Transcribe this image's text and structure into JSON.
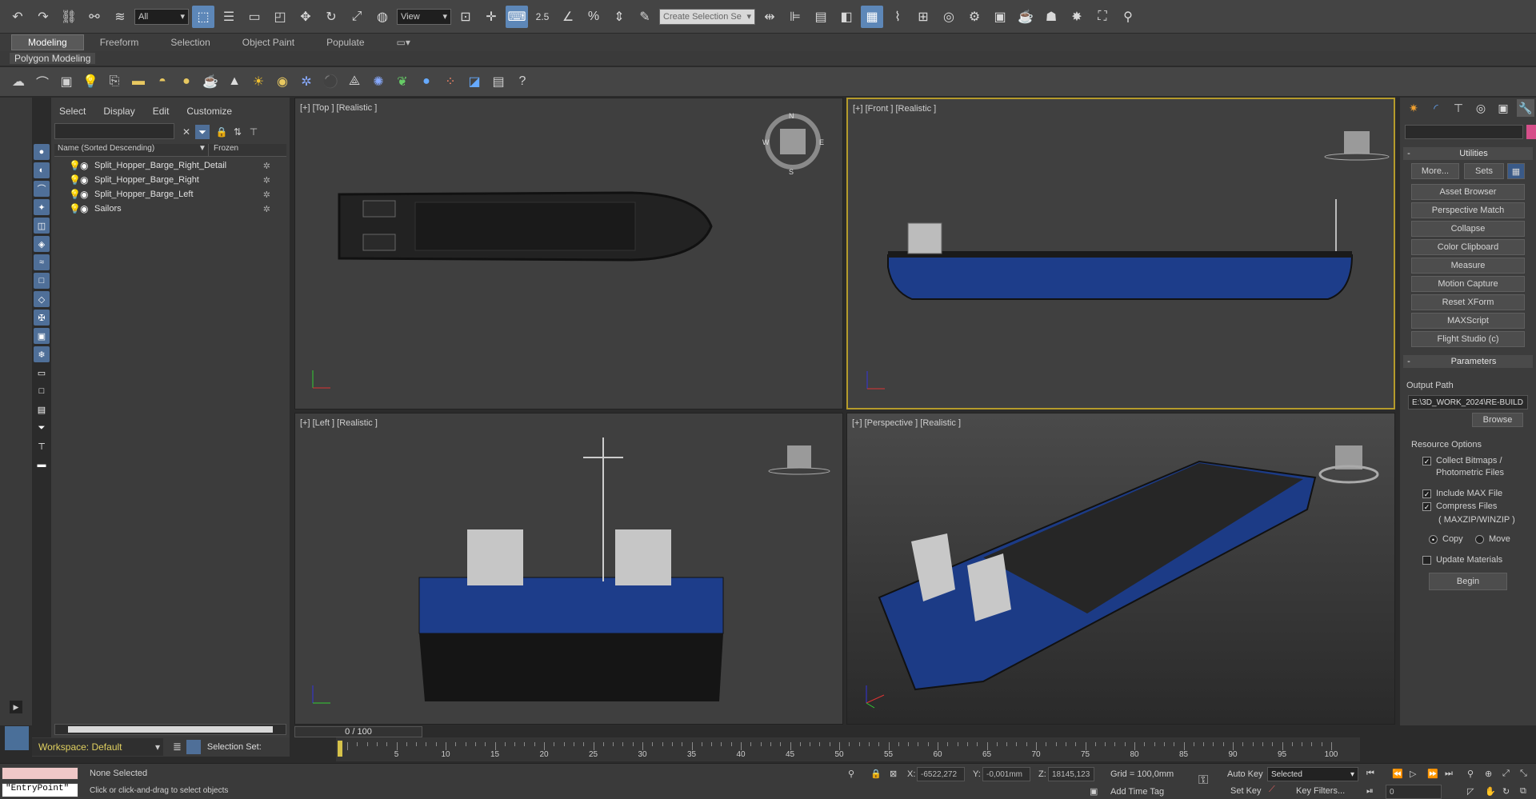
{
  "toolbar": {
    "filter_value": "All",
    "view_value": "View",
    "snap_value": "2.5",
    "selection_set_placeholder": "Create Selection Se"
  },
  "ribbon": {
    "tabs": [
      "Modeling",
      "Freeform",
      "Selection",
      "Object Paint",
      "Populate"
    ],
    "sub_label": "Polygon Modeling"
  },
  "scene_explorer": {
    "menu": [
      "Select",
      "Display",
      "Edit",
      "Customize"
    ],
    "col_name": "Name (Sorted Descending)",
    "col_frozen": "Frozen",
    "rows": [
      {
        "name": "Split_Hopper_Barge_Right_Detail"
      },
      {
        "name": "Split_Hopper_Barge_Right"
      },
      {
        "name": "Split_Hopper_Barge_Left"
      },
      {
        "name": "Sailors"
      }
    ]
  },
  "viewports": {
    "top": "[+] [Top ] [Realistic ]",
    "front": "[+] [Front ] [Realistic ]",
    "left": "[+] [Left ] [Realistic ]",
    "persp": "[+] [Perspective ] [Realistic ]"
  },
  "compass": {
    "n": "N",
    "s": "S",
    "e": "E",
    "w": "W"
  },
  "cmd_panel": {
    "utilities_title": "Utilities",
    "more": "More...",
    "sets": "Sets",
    "buttons": [
      "Asset Browser",
      "Perspective Match",
      "Collapse",
      "Color Clipboard",
      "Measure",
      "Motion Capture",
      "Reset XForm",
      "MAXScript",
      "Flight Studio (c)"
    ],
    "parameters_title": "Parameters",
    "output_path_label": "Output Path",
    "output_path_value": "E:\\3D_WORK_2024\\RE-BUILD",
    "browse": "Browse",
    "resource_options": "Resource Options",
    "collect_bitmaps": "Collect Bitmaps /",
    "photometric": "Photometric Files",
    "include_max": "Include MAX File",
    "compress": "Compress Files",
    "maxzip": "( MAXZIP/WINZIP )",
    "copy": "Copy",
    "move": "Move",
    "update_materials": "Update Materials",
    "begin": "Begin"
  },
  "bottom": {
    "workspace": "Workspace: Default",
    "selection_set": "Selection Set:",
    "frame_counter": "0 / 100",
    "ticks": [
      "5",
      "10",
      "15",
      "20",
      "25",
      "30",
      "35",
      "40",
      "45",
      "50",
      "55",
      "60",
      "65",
      "70",
      "75",
      "80",
      "85",
      "90",
      "95",
      "100"
    ],
    "entry_point": "\"EntryPoint\"",
    "none_selected": "None Selected",
    "hint": "Click or click-and-drag to select objects",
    "x_label": "X:",
    "x_value": "-6522,272",
    "y_label": "Y:",
    "y_value": "-0,001mm",
    "z_label": "Z:",
    "z_value": "18145,123",
    "grid": "Grid = 100,0mm",
    "add_time_tag": "Add Time Tag",
    "auto_key": "Auto Key",
    "key_mode": "Selected",
    "set_key": "Set Key",
    "key_filters": "Key Filters...",
    "frame_value": "0"
  }
}
